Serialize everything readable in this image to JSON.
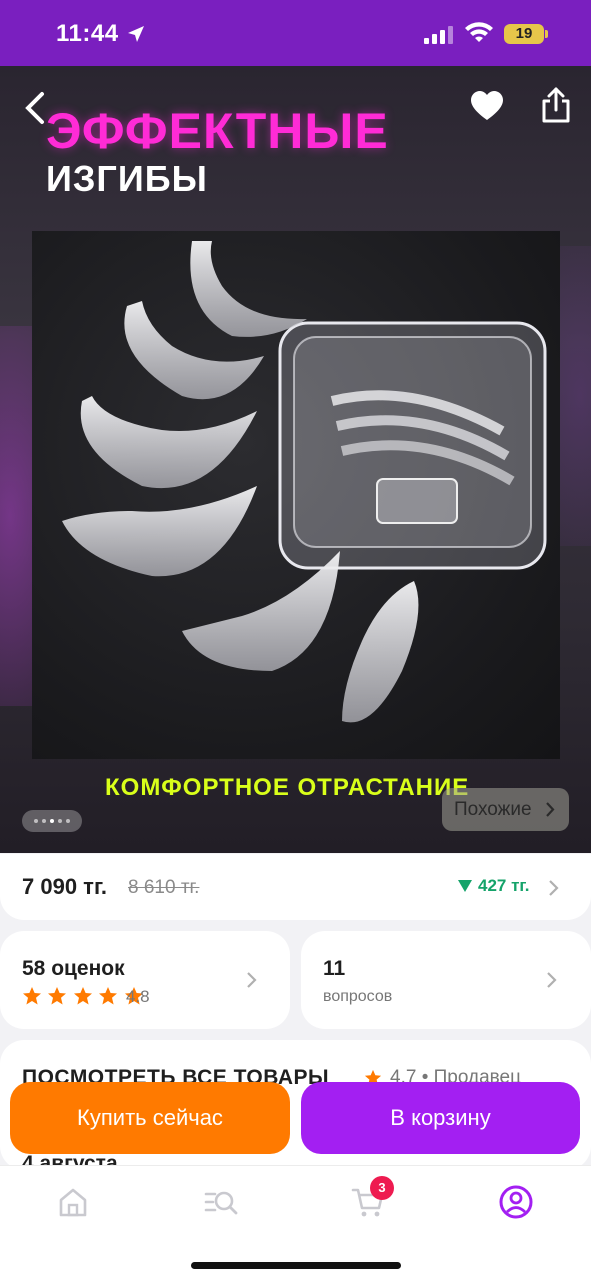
{
  "status_bar": {
    "time": "11:44",
    "battery": "19"
  },
  "hero": {
    "title_line1": "ЭФФЕКТНЫЕ",
    "title_line2": "ИЗГИБЫ",
    "bottom_text": "КОМФОРТНОЕ ОТРАСТАНИЕ",
    "similar_label": "Похожие"
  },
  "price": {
    "current": "7 090 тг.",
    "old": "8 610 тг.",
    "cashback": "427 тг."
  },
  "reviews": {
    "count_label": "58 оценок",
    "rating": "4.8",
    "stars": 5
  },
  "questions": {
    "count": "11",
    "label": "вопросов"
  },
  "seller": {
    "title": "ПОСМОТРЕТЬ ВСЕ ТОВАРЫ",
    "rating_text": "4.7 • Продавец"
  },
  "delivery": {
    "date": "4 августа"
  },
  "actions": {
    "buy_now": "Купить сейчас",
    "add_to_cart": "В корзину"
  },
  "tabbar": {
    "cart_badge": "3"
  },
  "colors": {
    "accent": "#a31ff2",
    "orange": "#ff7a00",
    "header": "#7a1fbf",
    "cashback": "#15a36a"
  }
}
